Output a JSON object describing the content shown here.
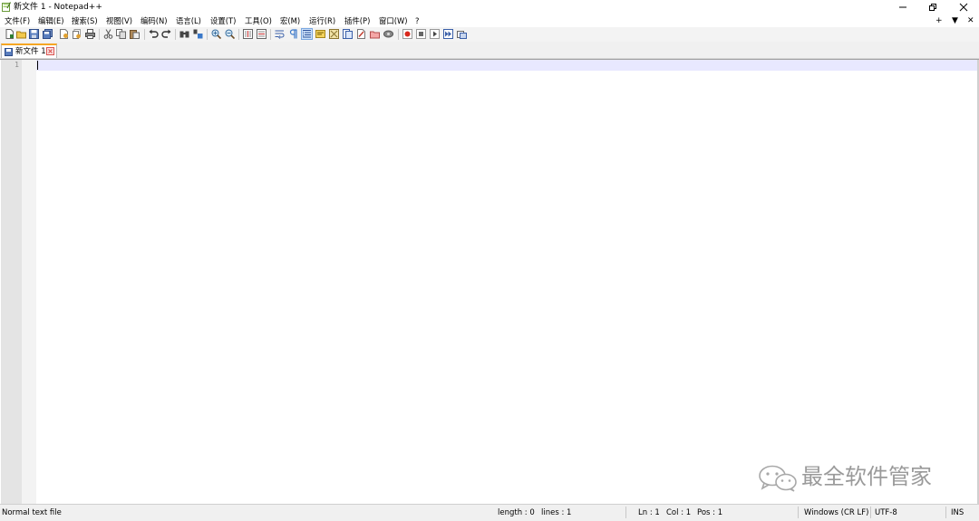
{
  "window": {
    "title": "新文件 1 - Notepad++",
    "minimize_glyph": "—",
    "restore_glyph": "❐",
    "close_glyph": "✕"
  },
  "menubar": {
    "items": [
      "文件(F)",
      "编辑(E)",
      "搜索(S)",
      "视图(V)",
      "编码(N)",
      "语言(L)",
      "设置(T)",
      "工具(O)",
      "宏(M)",
      "运行(R)",
      "插件(P)",
      "窗口(W)",
      "?"
    ],
    "right": {
      "add": "+",
      "dropdown": "▼",
      "close": "✕"
    }
  },
  "toolbar": {
    "icons": [
      "new-file-icon",
      "open-file-icon",
      "save-icon",
      "save-all-icon",
      "close-icon",
      "close-all-icon",
      "print-icon",
      "cut-icon",
      "copy-icon",
      "paste-icon",
      "undo-icon",
      "redo-icon",
      "find-icon",
      "replace-icon",
      "zoom-in-icon",
      "zoom-out-icon",
      "sync-vertical-icon",
      "sync-horizontal-icon",
      "word-wrap-icon",
      "show-all-chars-icon",
      "indent-guide-icon",
      "user-language-icon",
      "doc-map-icon",
      "function-list-icon",
      "folder-workspace-icon",
      "monitoring-icon",
      "record-macro-icon",
      "stop-record-icon",
      "play-macro-icon",
      "run-macro-multiple-icon",
      "save-macro-icon"
    ]
  },
  "tabs": [
    {
      "label": "新文件 1",
      "active": true
    }
  ],
  "editor": {
    "line_numbers": [
      "1"
    ],
    "content": ""
  },
  "watermark": {
    "text": "最全软件管家",
    "icon": "wechat-icon"
  },
  "statusbar": {
    "file_type": "Normal text file",
    "length": "length : 0",
    "lines": "lines : 1",
    "ln": "Ln : 1",
    "col": "Col : 1",
    "pos": "Pos : 1",
    "eol": "Windows (CR LF)",
    "encoding": "UTF-8",
    "mode": "INS"
  },
  "colors": {
    "current_line": "#e8e8ff",
    "tab_accent": "#f5a623",
    "gutter": "#e4e4e4",
    "record_red": "#d9281c"
  }
}
